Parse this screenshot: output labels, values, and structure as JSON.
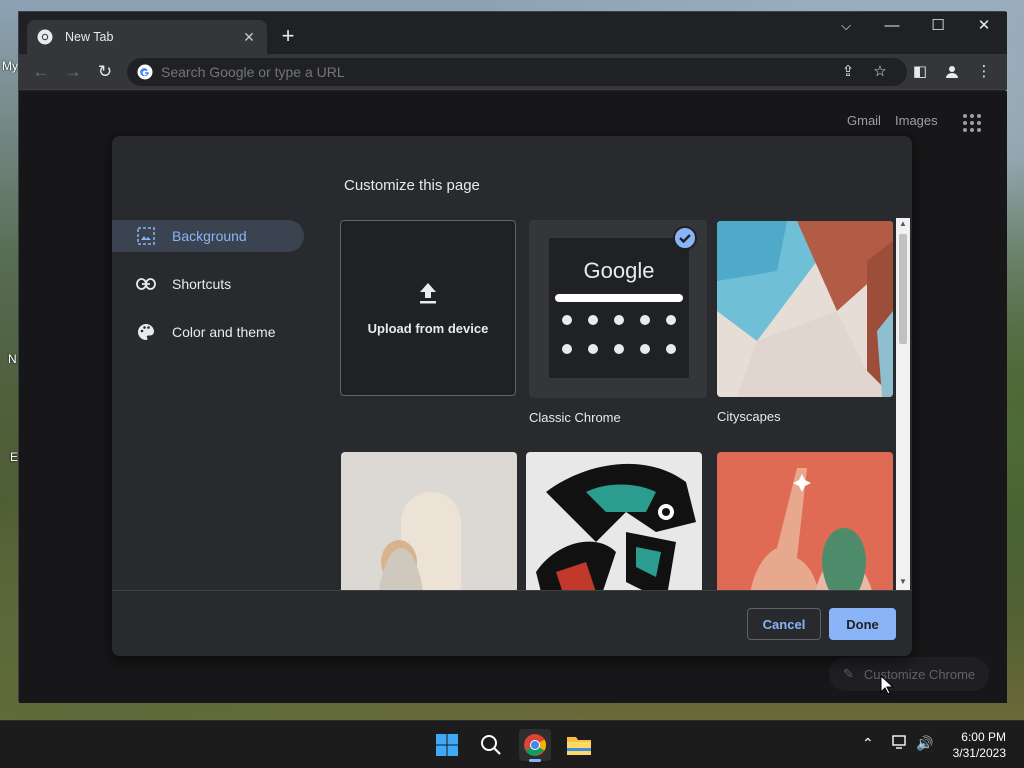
{
  "desktop": {
    "icon_labels": [
      "My",
      "N",
      "E"
    ]
  },
  "browser": {
    "tab_title": "New Tab",
    "tab_close": "✕",
    "new_tab": "+",
    "window_controls": {
      "tabsearch": "⌵",
      "minimize": "—",
      "maximize": "☐",
      "close": "✕"
    },
    "omnibox_placeholder": "Search Google or type a URL",
    "top_links": {
      "gmail": "Gmail",
      "images": "Images"
    },
    "customize_chip": "Customize Chrome"
  },
  "dialog": {
    "title": "Customize this page",
    "menu": [
      {
        "label": "Background",
        "active": true
      },
      {
        "label": "Shortcuts",
        "active": false
      },
      {
        "label": "Color and theme",
        "active": false
      }
    ],
    "tiles": {
      "upload": "Upload from device",
      "classic_label": "Classic Chrome",
      "classic_logo": "Google",
      "cityscapes": "Cityscapes"
    },
    "cancel": "Cancel",
    "done": "Done"
  },
  "taskbar": {
    "time": "6:00 PM",
    "date": "3/31/2023"
  },
  "colors": {
    "accent": "#8ab4f8",
    "dialog_bg": "#292a2d",
    "window_bg": "#202124"
  }
}
